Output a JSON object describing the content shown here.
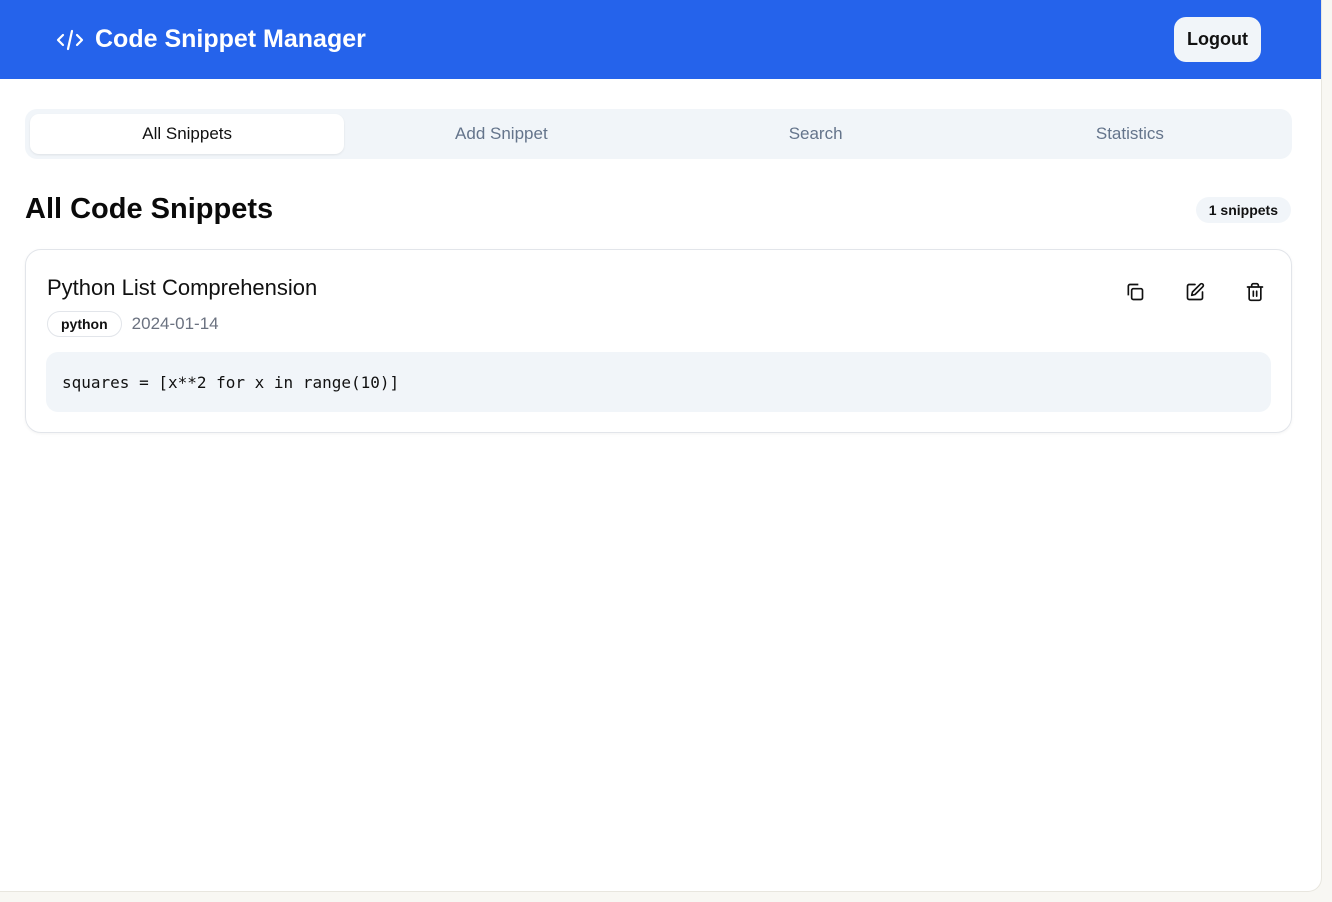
{
  "header": {
    "title": "Code Snippet Manager",
    "logout": "Logout"
  },
  "tabs": [
    "All Snippets",
    "Add Snippet",
    "Search",
    "Statistics"
  ],
  "main": {
    "heading": "All Code Snippets",
    "count": "1 snippets",
    "snippets": [
      {
        "title": "Python List Comprehension",
        "language": "python",
        "date": "2024-01-14",
        "code": "squares = [x**2 for x in range(10)]"
      }
    ]
  }
}
